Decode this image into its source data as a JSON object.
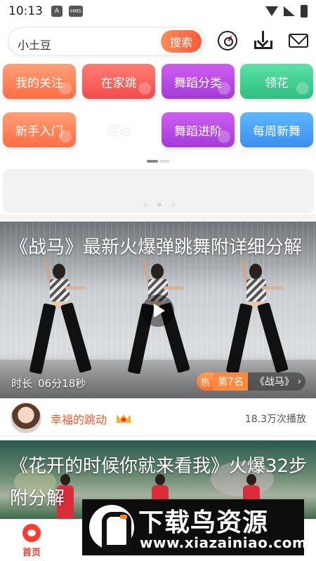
{
  "status_bar": {
    "time": "10:13",
    "icon_a": "A",
    "icon_hms": "HMS"
  },
  "header": {
    "search_value": "小土豆",
    "search_button": "搜索",
    "icons": [
      "music-disc-icon",
      "download-icon",
      "mail-icon"
    ]
  },
  "categories": [
    {
      "label": "我的关注",
      "color": "#ff7a4c"
    },
    {
      "label": "在家跳",
      "color": "#f45a55"
    },
    {
      "label": "舞蹈分类",
      "color": "#b848e3"
    },
    {
      "label": "领花",
      "color": "#3fcc8d"
    },
    {
      "label": "新手入门",
      "color": "#ff7a4c"
    },
    {
      "label": "活动",
      "color": "#eeeeee"
    },
    {
      "label": "舞蹈进阶",
      "color": "#b848e3"
    },
    {
      "label": "每周新舞",
      "color": "#4aa3f7"
    }
  ],
  "feed": [
    {
      "title": "《战马》最新火爆弹跳舞附详细分解",
      "duration_label": "时长",
      "duration": "06分18秒",
      "rank_hot": "热",
      "rank": "第7名",
      "rank_song": "《战马》",
      "author": "幸福的跳动",
      "plays": "18.3万次播放"
    },
    {
      "title": "《花开的时候你就来看我》火爆32步附分解"
    }
  ],
  "bottom_nav": {
    "items": [
      "首页"
    ]
  },
  "watermark": {
    "title": "下载鸟资源",
    "url": "www.xiazainiao.com"
  },
  "colors": {
    "accent": "#ff5a3a",
    "author": "#ff5a2a",
    "nav_active": "#ff3b2f"
  }
}
